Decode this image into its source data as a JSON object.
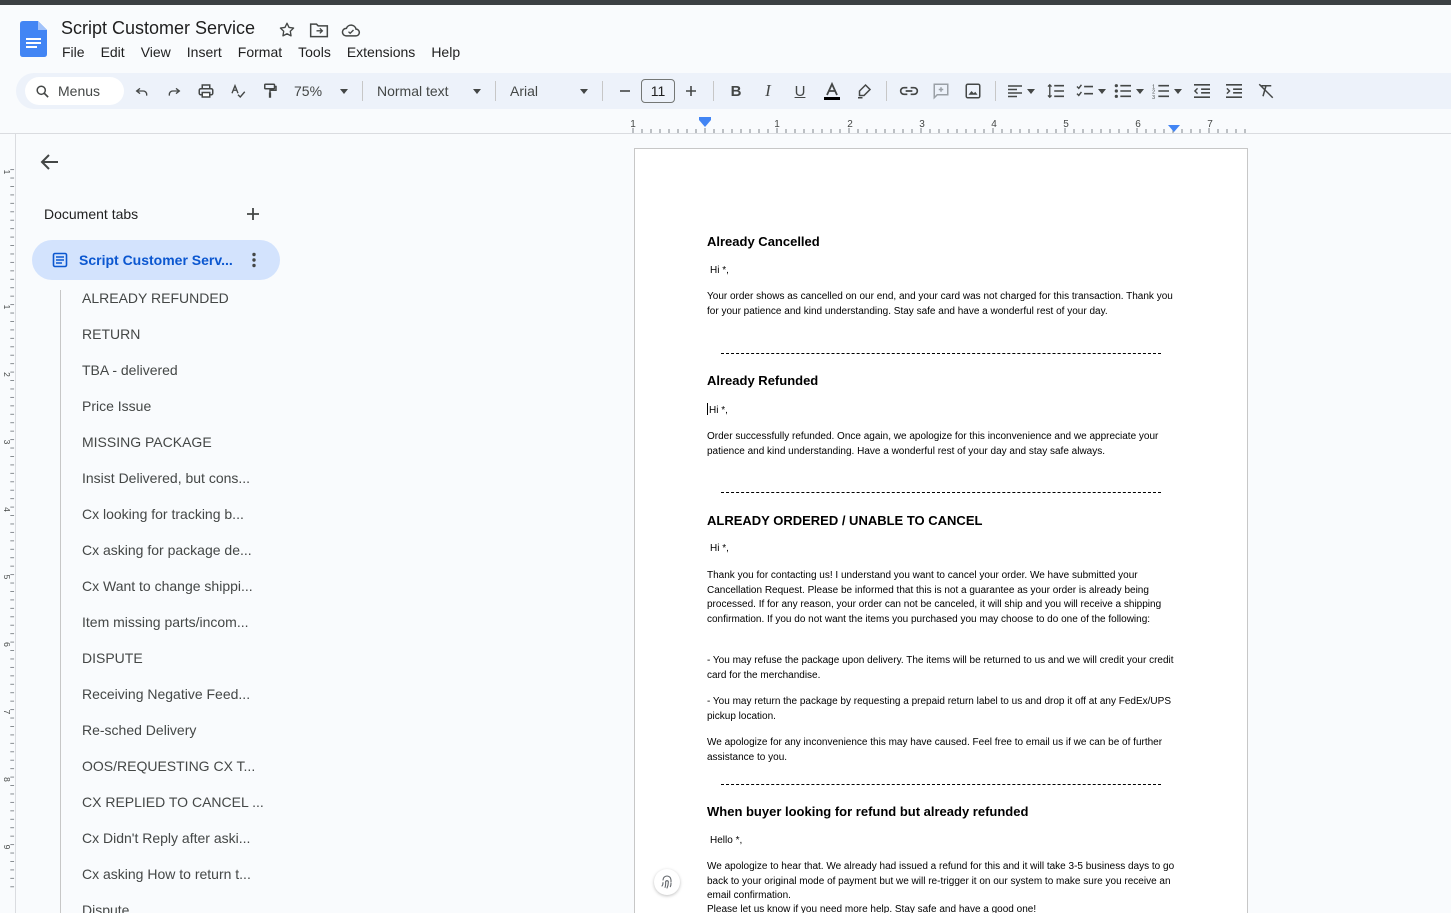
{
  "header": {
    "title": "Script Customer Service",
    "menu": [
      "File",
      "Edit",
      "View",
      "Insert",
      "Format",
      "Tools",
      "Extensions",
      "Help"
    ]
  },
  "toolbar": {
    "search_label": "Menus",
    "zoom": "75%",
    "style": "Normal text",
    "font": "Arial",
    "font_size": "11"
  },
  "ruler": {
    "h_labels": [
      "1",
      "1",
      "2",
      "3",
      "4",
      "5",
      "6",
      "7"
    ],
    "v_labels": [
      "1",
      "1",
      "2",
      "3",
      "4",
      "5",
      "6",
      "7",
      "8",
      "9"
    ]
  },
  "sidebar": {
    "tabs_label": "Document tabs",
    "active_tab": "Script Customer Serv...",
    "outline": [
      "ALREADY REFUNDED",
      "RETURN",
      "TBA - delivered",
      "Price Issue",
      "MISSING PACKAGE",
      "Insist Delivered, but cons...",
      "Cx looking for tracking b...",
      "Cx asking for package de...",
      "Cx Want to change shippi...",
      "Item missing parts/incom...",
      "DISPUTE",
      "Receiving Negative Feed...",
      "Re-sched Delivery",
      "OOS/REQUESTING CX T...",
      "CX REPLIED TO CANCEL ...",
      "Cx Didn't Reply after aski...",
      "Cx asking How to return t...",
      "Dispute"
    ]
  },
  "doc": {
    "h1": "Already Cancelled",
    "hi1": "Hi *,",
    "p1": "Your order shows as cancelled on our end, and your card was not charged for this transaction. Thank you for your patience and kind understanding. Stay safe and have a wonderful rest of your day.",
    "h2": "Already Refunded",
    "hi2": "Hi *,",
    "p2": "Order successfully refunded. Once again, we apologize for this inconvenience and we appreciate your patience and kind understanding. Have a wonderful rest of your day and stay safe always.",
    "h3": "ALREADY ORDERED / UNABLE TO CANCEL",
    "hi3": "Hi *,",
    "p3": "Thank you for contacting us! I understand you want to cancel your order. We have submitted your Cancellation Request. Please be informed that this is not a guarantee as your order is already being processed. If for any reason, your order can not be canceled, it will ship and you will receive a shipping confirmation. If you do not want the items you purchased you may choose to do one of the following:",
    "p4": "- You may refuse the package upon delivery. The items will be returned to us and we will credit your credit card for the merchandise.",
    "p5": "- You may return the package by requesting a prepaid return label to us and drop it off at any FedEx/UPS pickup location.",
    "p6": "We apologize for any inconvenience this may have caused. Feel free to email us if we can be of further assistance to you.",
    "h4": "When buyer looking for refund but already refunded",
    "hello": "Hello *,",
    "p7": "We apologize to hear that. We already had issued a refund for this and it will take 3-5 business days to go back to your original mode of payment but we will re-trigger it on our system to make sure you receive an email confirmation.",
    "p8": "Please let us know if you need more help. Stay safe and have a good one!"
  }
}
